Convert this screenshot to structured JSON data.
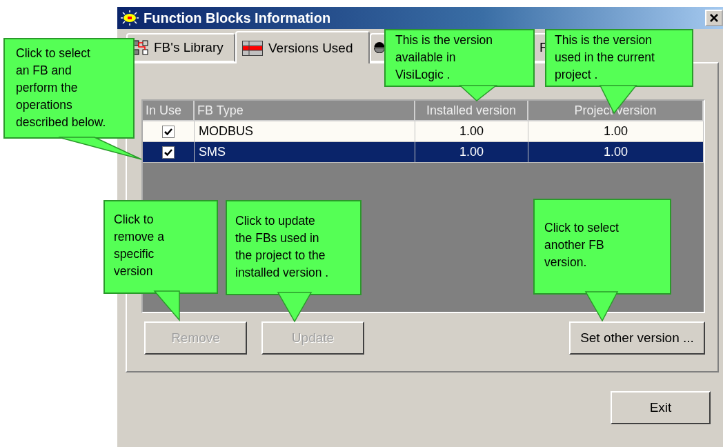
{
  "window": {
    "title": "Function Blocks Information"
  },
  "tabs": [
    {
      "label": "FB's Library",
      "selected": false
    },
    {
      "label": "Versions Used",
      "selected": true
    },
    {
      "selected": false
    },
    {
      "label": "F",
      "selected": false
    }
  ],
  "table": {
    "columns": [
      "In Use",
      "FB Type",
      "Installed version",
      "Project version"
    ],
    "rows": [
      {
        "in_use": true,
        "fb_type": "MODBUS",
        "installed_version": "1.00",
        "project_version": "1.00",
        "selected": false
      },
      {
        "in_use": true,
        "fb_type": "SMS",
        "installed_version": "1.00",
        "project_version": "1.00",
        "selected": true
      }
    ]
  },
  "buttons": [
    {
      "label": "Remove",
      "disabled": true
    },
    {
      "label": "Update",
      "disabled": true
    },
    {
      "label": "Set other version ...",
      "disabled": false
    }
  ],
  "exit_button": {
    "label": "Exit",
    "disabled": false
  },
  "callouts": [
    {
      "text": "Click to select\nan FB and\nperform the\noperations\ndescribed below."
    },
    {
      "text": "This is the version\navailable  in\nVisiLogic ."
    },
    {
      "text": "This is the version\nused in the current\nproject ."
    },
    {
      "text": "Click  to\nremove  a\nspecific\nversion"
    },
    {
      "text": "Click to update\nthe FBs used  in\nthe project to the\ninstalled version ."
    },
    {
      "text": "Click to select\nanother   FB\nversion."
    }
  ]
}
